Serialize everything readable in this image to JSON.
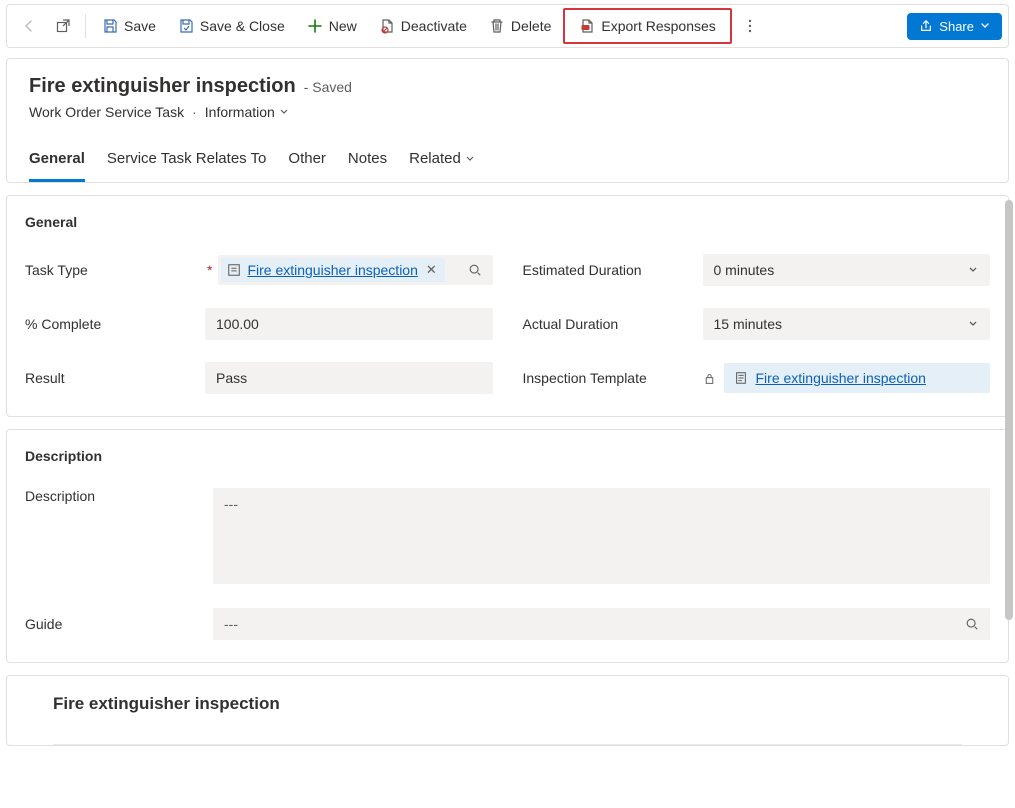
{
  "commandBar": {
    "save": "Save",
    "saveClose": "Save & Close",
    "new": "New",
    "deactivate": "Deactivate",
    "delete": "Delete",
    "exportResponses": "Export Responses",
    "share": "Share"
  },
  "header": {
    "title": "Fire extinguisher inspection",
    "saveState": "- Saved",
    "entity": "Work Order Service Task",
    "view": "Information"
  },
  "tabs": {
    "general": "General",
    "relates": "Service Task Relates To",
    "other": "Other",
    "notes": "Notes",
    "related": "Related"
  },
  "sections": {
    "general": {
      "title": "General",
      "fields": {
        "taskTypeLabel": "Task Type",
        "taskTypeValue": "Fire extinguisher inspection",
        "pctCompleteLabel": "% Complete",
        "pctCompleteValue": "100.00",
        "resultLabel": "Result",
        "resultValue": "Pass",
        "estDurationLabel": "Estimated Duration",
        "estDurationValue": "0 minutes",
        "actDurationLabel": "Actual Duration",
        "actDurationValue": "15 minutes",
        "inspTemplateLabel": "Inspection Template",
        "inspTemplateValue": "Fire extinguisher inspection"
      }
    },
    "description": {
      "title": "Description",
      "descriptionLabel": "Description",
      "descriptionValue": "---",
      "guideLabel": "Guide",
      "guideValue": "---"
    },
    "inspection": {
      "title": "Fire extinguisher inspection"
    }
  }
}
